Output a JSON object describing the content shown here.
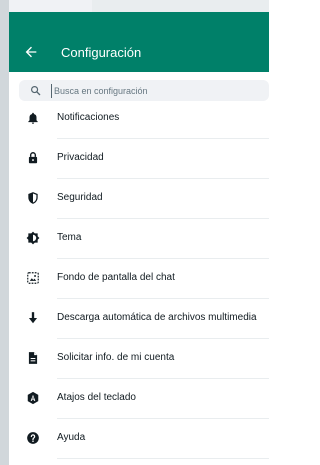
{
  "header": {
    "title": "Configuración"
  },
  "search": {
    "placeholder": "Busca en configuración"
  },
  "menu": {
    "items": [
      {
        "label": "Notificaciones",
        "icon": "bell-icon"
      },
      {
        "label": "Privacidad",
        "icon": "lock-icon"
      },
      {
        "label": "Seguridad",
        "icon": "shield-icon"
      },
      {
        "label": "Tema",
        "icon": "theme-icon"
      },
      {
        "label": "Fondo de pantalla del chat",
        "icon": "wallpaper-icon"
      },
      {
        "label": "Descarga automática de archivos multimedia",
        "icon": "download-icon"
      },
      {
        "label": "Solicitar info. de mi cuenta",
        "icon": "document-icon"
      },
      {
        "label": "Atajos del teclado",
        "icon": "keyboard-shortcuts-icon"
      },
      {
        "label": "Ayuda",
        "icon": "help-icon"
      }
    ]
  },
  "colors": {
    "header": "#008069",
    "icon": "#54656f",
    "text": "#111b21",
    "search_bg": "#f0f2f5"
  }
}
